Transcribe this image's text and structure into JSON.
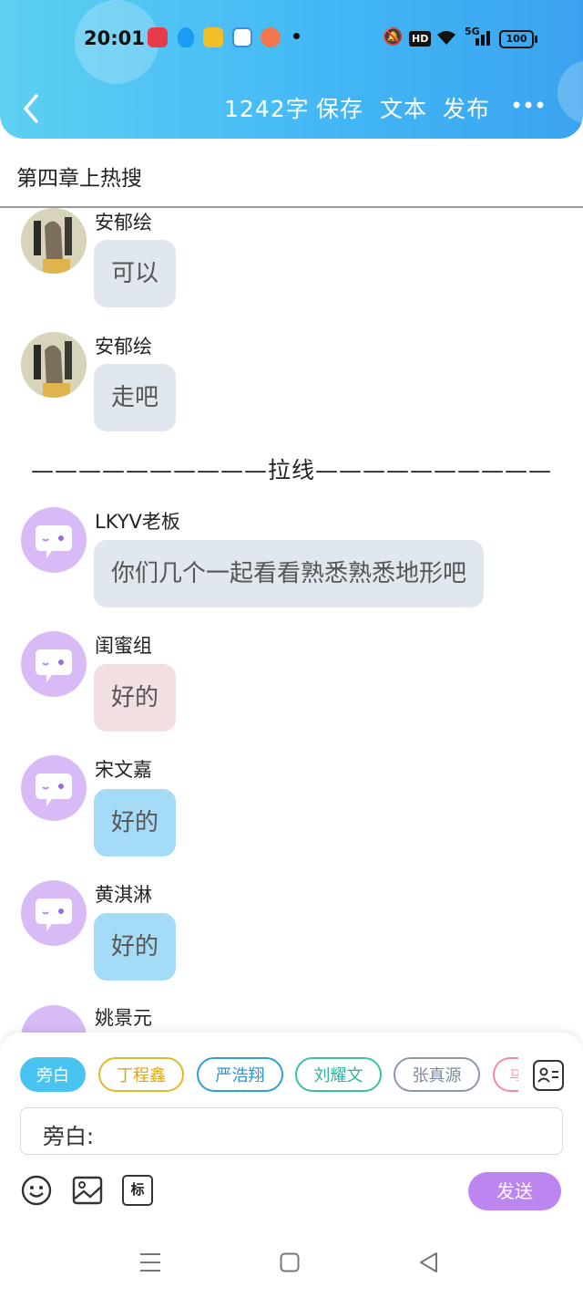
{
  "status_bar": {
    "time": "20:01",
    "network": "5G",
    "battery": "100",
    "hd": "HD"
  },
  "toolbar": {
    "word_count": "1242字",
    "save_label": "保存",
    "text_label": "文本",
    "publish_label": "发布"
  },
  "chapter_title": "第四章上热搜",
  "messages": [
    {
      "name": "安郁绘",
      "text": "可以"
    },
    {
      "name": "安郁绘",
      "text": "走吧"
    },
    {
      "name": "LKYV老板",
      "text": "你们几个一起看看熟悉熟悉地形吧"
    },
    {
      "name": "闺蜜组",
      "text": "好的"
    },
    {
      "name": "宋文嘉",
      "text": "好的"
    },
    {
      "name": "黄淇淋",
      "text": "好的"
    },
    {
      "name": "姚景元",
      "text": ""
    }
  ],
  "divider": "——————————拉线——————————",
  "role_chips": [
    {
      "label": "旁白",
      "color": "#49c3f0"
    },
    {
      "label": "丁程鑫",
      "color": "#e0b82d"
    },
    {
      "label": "严浩翔",
      "color": "#2f9fd6"
    },
    {
      "label": "刘耀文",
      "color": "#3cbfa6"
    },
    {
      "label": "张真源",
      "color": "#8a9aae"
    },
    {
      "label": "马",
      "color": "#f08aa0"
    }
  ],
  "composer": {
    "prefix": "旁白:",
    "send_label": "发送",
    "mark_label": "标"
  },
  "colors": {
    "header_start": "#5ed0f2",
    "header_end": "#3aa3f0",
    "send_button": "#bd85f0",
    "avatar_bg": "#d7baf6"
  }
}
